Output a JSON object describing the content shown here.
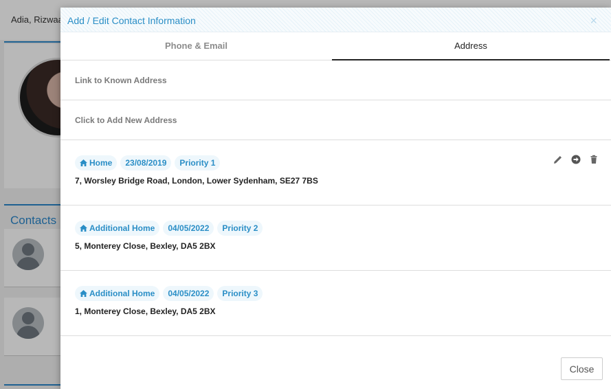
{
  "background": {
    "person_name": "Adia, Rizwaa",
    "contacts_heading": "Contacts"
  },
  "modal": {
    "title": "Add / Edit Contact Information",
    "close_glyph": "×",
    "tabs": [
      {
        "label": "Phone & Email",
        "active": false
      },
      {
        "label": "Address",
        "active": true
      }
    ],
    "link_known": "Link to Known Address",
    "add_new": "Click to Add New Address",
    "addresses": [
      {
        "type": "Home",
        "date": "23/08/2019",
        "priority": "Priority 1",
        "line": "7, Worsley Bridge Road, London, Lower Sydenham, SE27 7BS"
      },
      {
        "type": "Additional Home",
        "date": "04/05/2022",
        "priority": "Priority 2",
        "line": "5, Monterey Close, Bexley, DA5 2BX"
      },
      {
        "type": "Additional Home",
        "date": "04/05/2022",
        "priority": "Priority 3",
        "line": "1, Monterey Close, Bexley, DA5 2BX"
      }
    ],
    "close_button": "Close"
  },
  "colors": {
    "accent": "#2a8ec6",
    "chip_bg": "#eef7fc",
    "icon": "#666666"
  },
  "icons": {
    "address_type": "home-icon",
    "edit": "pencil-icon",
    "move": "arrow-circle-right-icon",
    "delete": "trash-icon"
  }
}
